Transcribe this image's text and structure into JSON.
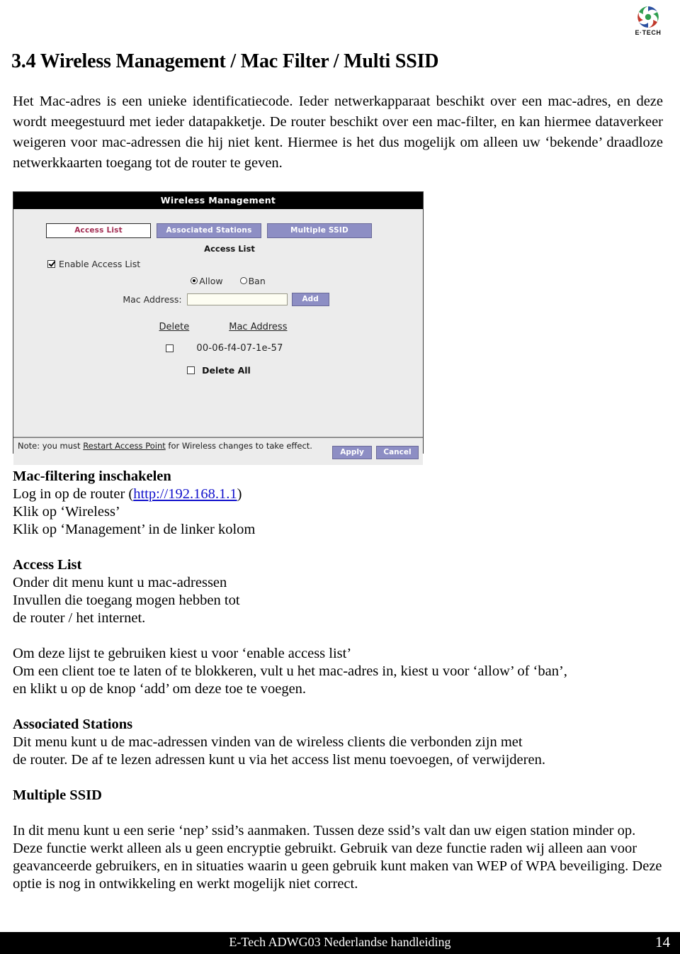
{
  "brand": {
    "name": "E·TECH",
    "trademark": "®",
    "colors": {
      "red": "#c0392b",
      "green": "#2e9e4f",
      "blue": "#2a4fa0"
    }
  },
  "document": {
    "title": "3.4 Wireless Management / Mac Filter / Multi SSID",
    "intro": "Het Mac-adres is een unieke identificatiecode. Ieder netwerkapparaat beschikt over een mac-adres, en deze wordt meegestuurd met ieder datapakketje. De router beschikt over een mac-filter, en kan hiermee dataverkeer weigeren voor mac-adressen die hij niet kent. Hiermee is het dus mogelijk om alleen uw ‘bekende’ draadloze netwerkkaarten toegang tot de router te geven."
  },
  "screenshot": {
    "window_title": "Wireless Management",
    "tabs": [
      {
        "label": "Access List",
        "active": true
      },
      {
        "label": "Associated Stations",
        "active": false
      },
      {
        "label": "Multiple SSID",
        "active": false
      }
    ],
    "section_title": "Access List",
    "enable_checkbox": {
      "label": "Enable Access List",
      "checked": true
    },
    "radios": [
      {
        "label": "Allow",
        "selected": true
      },
      {
        "label": "Ban",
        "selected": false
      }
    ],
    "mac_field": {
      "label": "Mac Address:",
      "value": "",
      "placeholder": ""
    },
    "add_button": "Add",
    "table": {
      "headers": [
        "Delete",
        "Mac Address"
      ],
      "rows": [
        {
          "checked": false,
          "mac": "00-06-f4-07-1e-57"
        }
      ]
    },
    "delete_all": {
      "label": "Delete All",
      "checked": false
    },
    "note": {
      "prefix": "Note: you must ",
      "link": "Restart Access Point",
      "suffix": " for Wireless changes to take effect."
    },
    "apply_button": "Apply",
    "cancel_button": "Cancel",
    "colors": {
      "tab_inactive_bg": "#8d8ec4",
      "tab_active_text": "#a32d53",
      "panel_bg": "#ececec",
      "titlebar_bg": "#000000"
    }
  },
  "sections": {
    "macfilter": {
      "heading": "Mac-filtering inschakelen",
      "line1_pre": "Log in op de router (",
      "line1_link": "http://192.168.1.1",
      "line1_post": ")",
      "line2": "Klik op ‘Wireless’",
      "line3": "Klik op ‘Management’ in de linker kolom"
    },
    "accesslist": {
      "heading": "Access List",
      "line1": "Onder dit menu kunt u mac-adressen",
      "line2": "Invullen die toegang mogen hebben tot",
      "line3": "de router / het internet.",
      "para1": "Om deze lijst te gebruiken kiest u voor ‘enable access list’",
      "para2": "Om een client toe te laten of te blokkeren, vult u het mac-adres in, kiest u voor ‘allow’ of ‘ban’,",
      "para3": "en klikt u op de knop ‘add’ om deze toe te voegen."
    },
    "associated": {
      "heading": "Associated Stations",
      "line1": "Dit menu kunt u de mac-adressen vinden van de wireless clients die verbonden zijn met",
      "line2": "de router. De af te lezen adressen kunt u via het access list menu toevoegen, of verwijderen."
    },
    "multissid": {
      "heading": "Multiple SSID",
      "body": "In dit menu kunt u een serie ‘nep’ ssid’s aanmaken. Tussen deze ssid’s valt dan uw eigen station minder op. Deze functie werkt alleen als u geen encryptie gebruikt. Gebruik van deze functie raden wij alleen aan voor geavanceerde gebruikers, en in situaties waarin u geen gebruik kunt maken van WEP of WPA beveiliging. Deze optie is nog in ontwikkeling en werkt mogelijk niet correct."
    }
  },
  "footer": {
    "title": "E-Tech ADWG03 Nederlandse handleiding",
    "page_number": "14"
  }
}
